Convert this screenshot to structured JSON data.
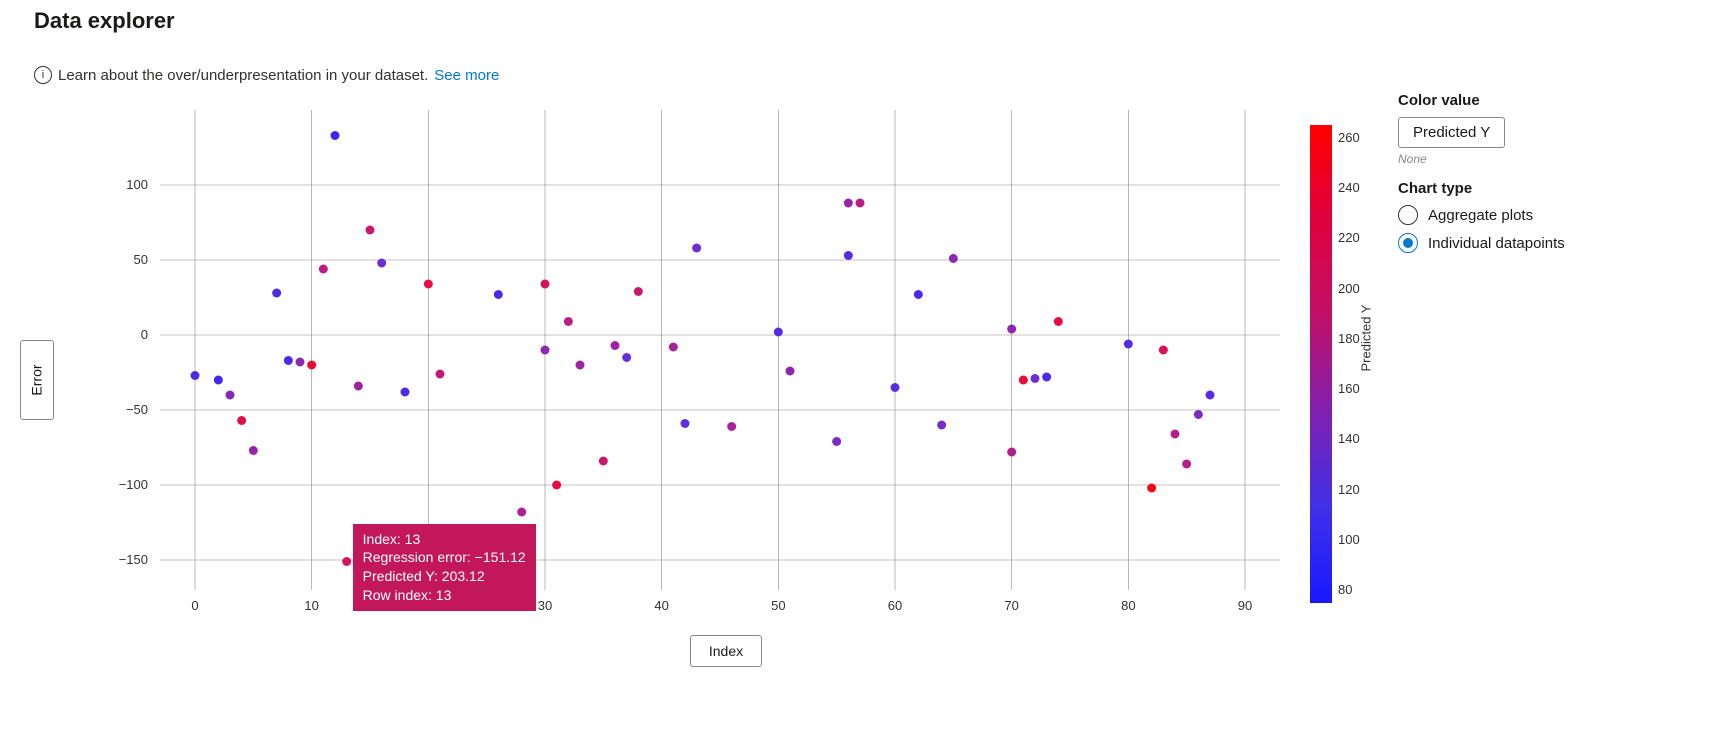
{
  "title": "Data explorer",
  "subtitle_text": "Learn about the over/underpresentation in your dataset.",
  "see_more": "See more",
  "chart": {
    "ylabel": "Error",
    "xlabel": "Index",
    "x_ticks": [
      0,
      10,
      20,
      30,
      40,
      50,
      60,
      70,
      80,
      90
    ],
    "y_ticks": [
      -150,
      -100,
      -50,
      0,
      50,
      100
    ],
    "x_range": [
      -3,
      93
    ],
    "y_range": [
      -170,
      150
    ]
  },
  "colorbar": {
    "label": "Predicted Y",
    "ticks": [
      260,
      240,
      220,
      200,
      180,
      160,
      140,
      120,
      100,
      80
    ],
    "min": 75,
    "max": 265
  },
  "tooltip": {
    "visible": true,
    "lines": [
      "Index: 13",
      "Regression error: −151.12",
      "Predicted Y: 203.12",
      "Row index: 13"
    ],
    "anchor_index": 13
  },
  "side": {
    "color_value_label": "Color value",
    "color_value_btn": "Predicted Y",
    "hint": "None",
    "chart_type_label": "Chart type",
    "radios": [
      {
        "label": "Aggregate plots",
        "selected": false
      },
      {
        "label": "Individual datapoints",
        "selected": true
      }
    ]
  },
  "chart_data": {
    "type": "scatter",
    "title": "",
    "xlabel": "Index",
    "ylabel": "Error",
    "xlim": [
      -3,
      93
    ],
    "ylim": [
      -170,
      150
    ],
    "color_field": "Predicted Y",
    "color_scale": {
      "min": 75,
      "max": 265,
      "low_color": "#1818ff",
      "high_color": "#ff0000"
    },
    "series": [
      {
        "name": "points",
        "x": [
          0,
          2,
          3,
          4,
          5,
          7,
          8,
          9,
          10,
          11,
          12,
          13,
          14,
          15,
          16,
          18,
          20,
          21,
          26,
          28,
          30,
          30,
          31,
          32,
          33,
          35,
          36,
          37,
          38,
          41,
          42,
          43,
          46,
          50,
          51,
          55,
          56,
          56,
          57,
          60,
          62,
          64,
          65,
          70,
          70,
          71,
          72,
          73,
          74,
          80,
          82,
          83,
          84,
          85,
          86,
          87
        ],
        "y": [
          -27,
          -30,
          -40,
          -57,
          -77,
          28,
          -17,
          -18,
          -20,
          44,
          133,
          -151,
          -34,
          70,
          48,
          -38,
          34,
          -26,
          27,
          -118,
          -10,
          34,
          -100,
          9,
          -20,
          -84,
          -7,
          -15,
          29,
          -8,
          -59,
          58,
          -61,
          2,
          -24,
          -71,
          88,
          53,
          88,
          -35,
          27,
          -60,
          51,
          4,
          -78,
          -30,
          -29,
          -28,
          9,
          -6,
          -102,
          -10,
          -66,
          -86,
          -53,
          -40
        ],
        "color": [
          110,
          105,
          145,
          225,
          155,
          110,
          110,
          150,
          235,
          180,
          100,
          203,
          160,
          195,
          130,
          110,
          225,
          190,
          110,
          170,
          150,
          210,
          225,
          180,
          160,
          195,
          160,
          125,
          195,
          165,
          120,
          130,
          165,
          115,
          150,
          140,
          155,
          115,
          180,
          120,
          110,
          135,
          150,
          150,
          175,
          235,
          130,
          110,
          225,
          115,
          250,
          215,
          175,
          175,
          140,
          115
        ]
      }
    ]
  }
}
